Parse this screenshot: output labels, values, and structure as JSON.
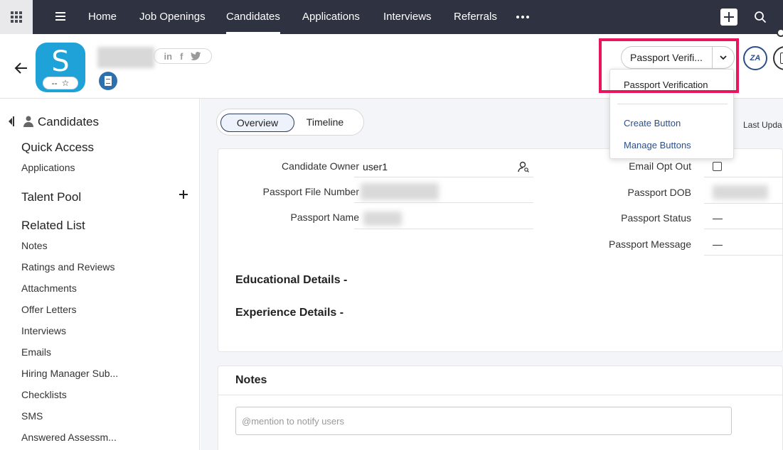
{
  "topnav": {
    "tabs": [
      {
        "label": "Home"
      },
      {
        "label": "Job Openings"
      },
      {
        "label": "Candidates"
      },
      {
        "label": "Applications"
      },
      {
        "label": "Interviews"
      },
      {
        "label": "Referrals"
      }
    ],
    "active_tab": "Candidates"
  },
  "header": {
    "avatar_letter": "S",
    "rating_text": "--",
    "star_glyph": "☆",
    "social": {
      "linkedin": "in",
      "facebook": "f"
    },
    "action_button_label": "Passport Verifi...",
    "zia_label": "ZA"
  },
  "dropdown": {
    "items": [
      {
        "label": "Passport Verification"
      },
      {
        "label": "Create Button"
      },
      {
        "label": "Manage Buttons"
      }
    ]
  },
  "sidebar": {
    "title": "Candidates",
    "sections": {
      "quick_access": "Quick Access",
      "talent_pool": "Talent Pool",
      "related_list": "Related List"
    },
    "quick_access_items": [
      "Applications"
    ],
    "related_items": [
      "Notes",
      "Ratings and Reviews",
      "Attachments",
      "Offer Letters",
      "Interviews",
      "Emails",
      "Hiring Manager Sub...",
      "Checklists",
      "SMS",
      "Answered Assessm..."
    ]
  },
  "main": {
    "tabs": [
      {
        "label": "Overview"
      },
      {
        "label": "Timeline"
      }
    ],
    "last_updated_label": "Last Upda",
    "fields_left": [
      {
        "label": "Candidate Owner",
        "value": "user1"
      },
      {
        "label": "Passport File Number",
        "value": ""
      },
      {
        "label": "Passport Name",
        "value": ""
      }
    ],
    "fields_right": [
      {
        "label": "Email Opt Out",
        "value": ""
      },
      {
        "label": "Passport DOB",
        "value": ""
      },
      {
        "label": "Passport Status",
        "value": "—"
      },
      {
        "label": "Passport Message",
        "value": "—"
      }
    ],
    "educational_details": "Educational Details -",
    "experience_details": "Experience Details -",
    "notes": {
      "title": "Notes",
      "placeholder": "@mention to notify users"
    }
  },
  "colors": {
    "topbar_bg": "#2f3241",
    "avatar_bg": "#1fa2d8",
    "highlight": "#e8155c",
    "link": "#2b4f8a"
  }
}
